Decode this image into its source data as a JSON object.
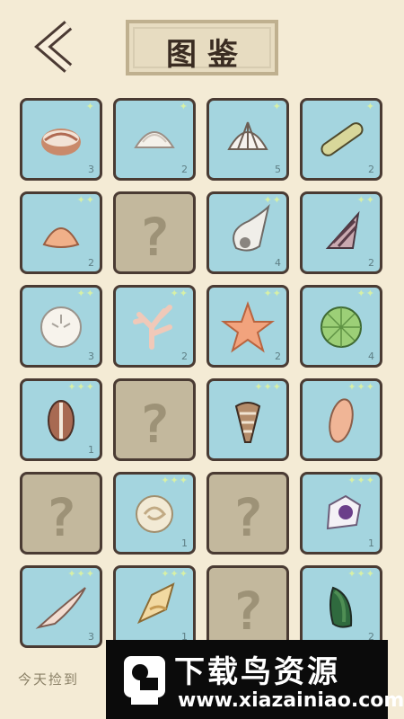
{
  "header": {
    "title": "图鉴"
  },
  "cards": [
    {
      "name": "card-scallop-brown",
      "count": "3",
      "stars": "✦",
      "locked": false
    },
    {
      "name": "card-clam-white",
      "count": "2",
      "stars": "✦",
      "locked": false
    },
    {
      "name": "card-cockle-white",
      "count": "5",
      "stars": "✦",
      "locked": false
    },
    {
      "name": "card-razor-clam",
      "count": "2",
      "stars": "✦",
      "locked": false
    },
    {
      "name": "card-clam-orange",
      "count": "2",
      "stars": "✦✦",
      "locked": false
    },
    {
      "name": "card-unknown-1",
      "count": "",
      "stars": "",
      "locked": true
    },
    {
      "name": "card-turban-shell",
      "count": "4",
      "stars": "✦✦",
      "locked": false
    },
    {
      "name": "card-cone-striped",
      "count": "2",
      "stars": "✦✦",
      "locked": false
    },
    {
      "name": "card-sand-dollar",
      "count": "3",
      "stars": "✦✦",
      "locked": false
    },
    {
      "name": "card-coral",
      "count": "2",
      "stars": "✦✦",
      "locked": false
    },
    {
      "name": "card-starfish",
      "count": "2",
      "stars": "✦✦",
      "locked": false
    },
    {
      "name": "card-sea-urchin",
      "count": "4",
      "stars": "✦✦",
      "locked": false
    },
    {
      "name": "card-cowrie",
      "count": "1",
      "stars": "✦✦✦",
      "locked": false
    },
    {
      "name": "card-unknown-2",
      "count": "",
      "stars": "",
      "locked": true
    },
    {
      "name": "card-cone-textile",
      "count": "",
      "stars": "✦✦✦",
      "locked": false
    },
    {
      "name": "card-olive-shell",
      "count": "",
      "stars": "✦✦✦",
      "locked": false
    },
    {
      "name": "card-unknown-3",
      "count": "",
      "stars": "",
      "locked": true
    },
    {
      "name": "card-moon-snail",
      "count": "1",
      "stars": "✦✦✦",
      "locked": false
    },
    {
      "name": "card-unknown-4",
      "count": "",
      "stars": "",
      "locked": true
    },
    {
      "name": "card-murex",
      "count": "1",
      "stars": "✦✦✦",
      "locked": false
    },
    {
      "name": "card-spindle-shell",
      "count": "3",
      "stars": "✦✦✦",
      "locked": false
    },
    {
      "name": "card-conch",
      "count": "1",
      "stars": "✦✦✦",
      "locked": false
    },
    {
      "name": "card-unknown-5",
      "count": "",
      "stars": "",
      "locked": true
    },
    {
      "name": "card-mussel",
      "count": "2",
      "stars": "✦✦✦",
      "locked": false
    }
  ],
  "footer": {
    "hint": "今天捡到"
  },
  "watermark": {
    "title": "下载鸟资源",
    "url": "www.xiazainiao.com"
  },
  "colors": {
    "bg": "#f4ebd5",
    "card": "#a4d5df",
    "locked": "#c3b89d",
    "border": "#4a3b33"
  }
}
